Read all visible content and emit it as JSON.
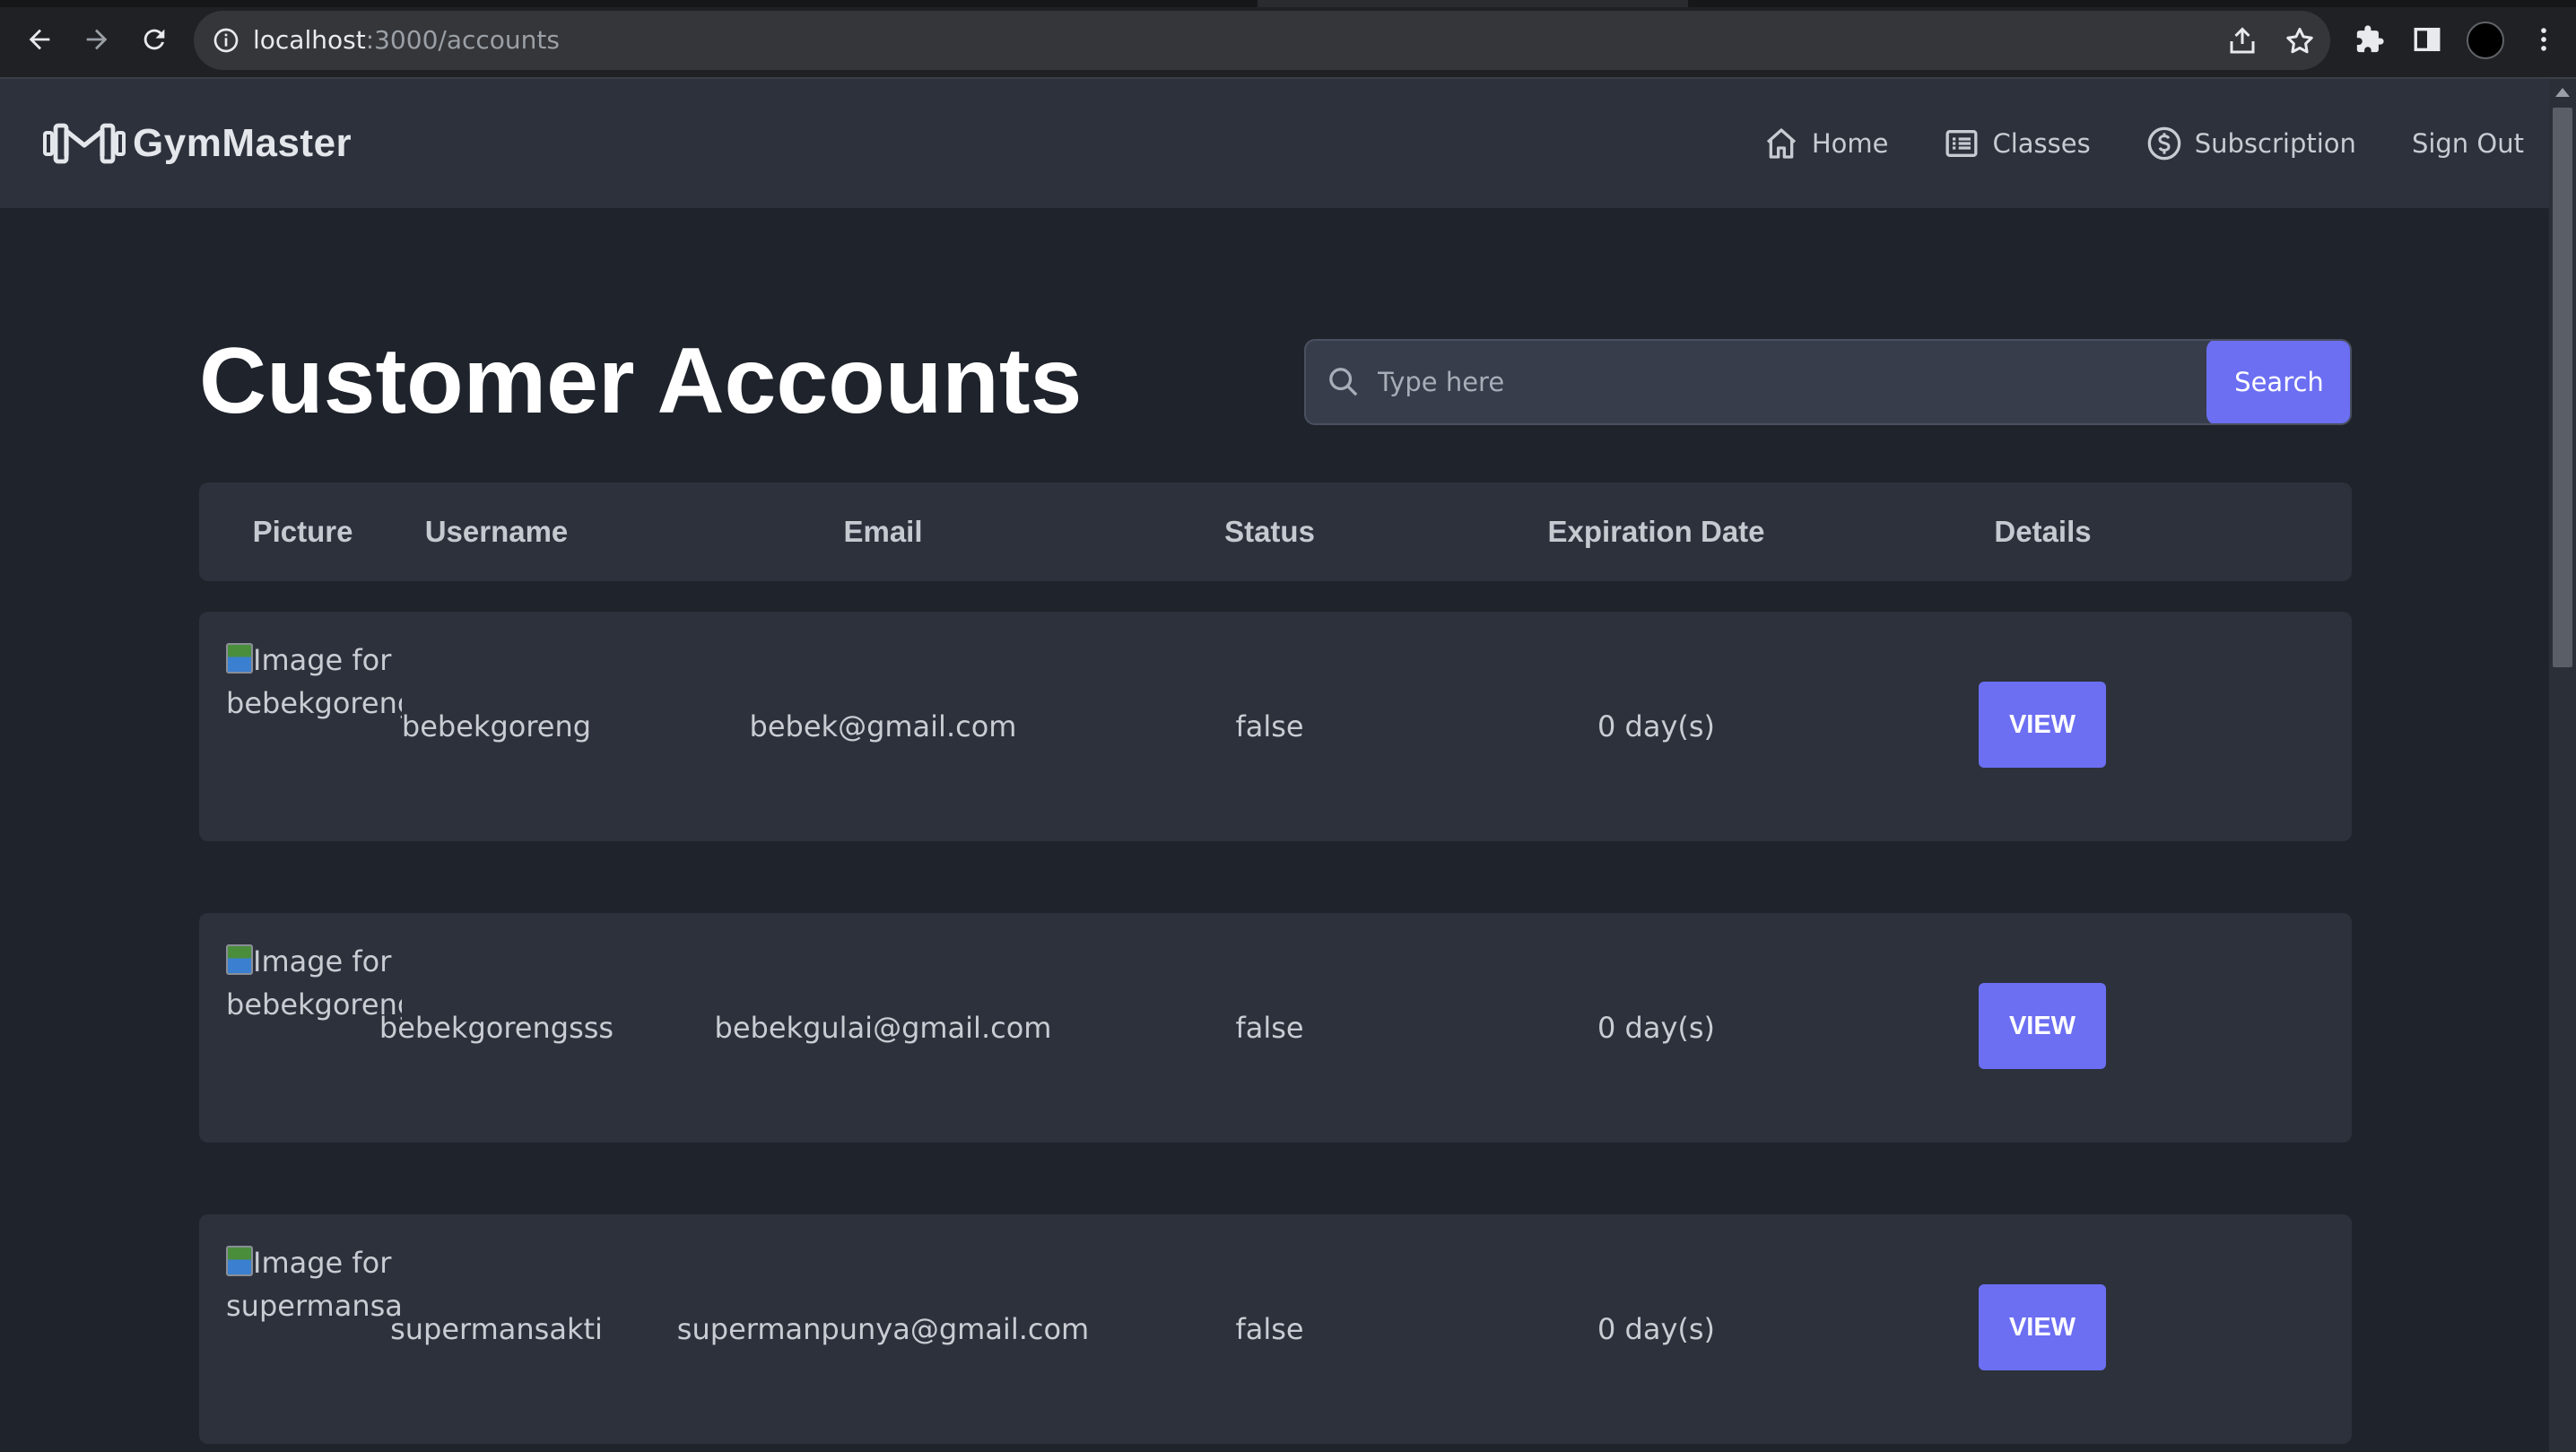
{
  "browser": {
    "url_host": "localhost",
    "url_path": ":3000/accounts"
  },
  "navbar": {
    "brand": "GymMaster",
    "links": [
      {
        "label": "Home",
        "icon": "home-icon"
      },
      {
        "label": "Classes",
        "icon": "list-icon"
      },
      {
        "label": "Subscription",
        "icon": "dollar-icon"
      },
      {
        "label": "Sign Out"
      }
    ]
  },
  "main": {
    "title": "Customer Accounts",
    "search": {
      "placeholder": "Type here",
      "value": "",
      "button": "Search"
    },
    "columns": [
      "Picture",
      "Username",
      "Email",
      "Status",
      "Expiration Date",
      "Details"
    ],
    "rows": [
      {
        "picture_alt": "Image for bebekgoreng",
        "username": "bebekgoreng",
        "email": "bebek@gmail.com",
        "status": "false",
        "expiration": "0 day(s)",
        "action": "VIEW"
      },
      {
        "picture_alt": "Image for bebekgorengsss",
        "username": "bebekgorengsss",
        "email": "bebekgulai@gmail.com",
        "status": "false",
        "expiration": "0 day(s)",
        "action": "VIEW"
      },
      {
        "picture_alt": "Image for supermansakti",
        "username": "supermansakti",
        "email": "supermanpunya@gmail.com",
        "status": "false",
        "expiration": "0 day(s)",
        "action": "VIEW"
      }
    ]
  },
  "colors": {
    "page_bg": "#1f232b",
    "card_bg": "#2c313c",
    "accent": "#6c6ff2"
  }
}
